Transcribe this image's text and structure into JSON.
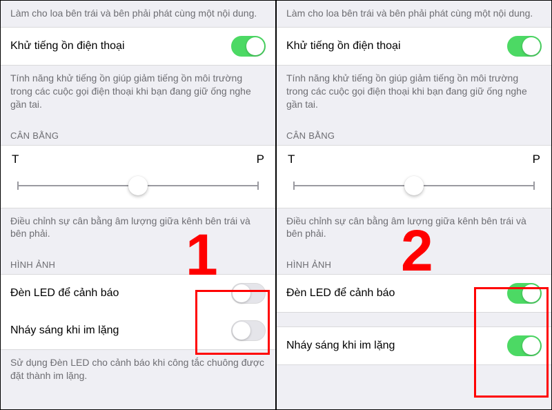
{
  "left": {
    "mono_footer": "Làm cho loa bên trái và bên phải phát cùng một nội dung.",
    "noise_cancel": {
      "label": "Khử tiếng ồn điện thoại",
      "on": true
    },
    "noise_footer": "Tính năng khử tiếng ồn giúp giảm tiếng ồn môi trường trong các cuộc gọi điện thoại khi bạn đang giữ ống nghe gần tai.",
    "balance_header": "CÂN BẰNG",
    "balance": {
      "left_label": "T",
      "right_label": "P",
      "value": 0.5
    },
    "balance_footer": "Điều chỉnh sự cân bằng âm lượng giữa kênh bên trái và bên phải.",
    "visual_header": "HÌNH ẢNH",
    "led_alert": {
      "label": "Đèn LED để cảnh báo",
      "on": false
    },
    "flash_silent": {
      "label": "Nháy sáng khi im lặng",
      "on": false
    },
    "led_footer": "Sử dụng Đèn LED cho cảnh báo khi công tắc chuông được đặt thành im lặng."
  },
  "right": {
    "mono_footer": "Làm cho loa bên trái và bên phải phát cùng một nội dung.",
    "noise_cancel": {
      "label": "Khử tiếng ồn điện thoại",
      "on": true
    },
    "noise_footer": "Tính năng khử tiếng ồn giúp giảm tiếng ồn môi trường trong các cuộc gọi điện thoại khi bạn đang giữ ống nghe gần tai.",
    "balance_header": "CÂN BẰNG",
    "balance": {
      "left_label": "T",
      "right_label": "P",
      "value": 0.5
    },
    "balance_footer": "Điều chỉnh sự cân bằng âm lượng giữa kênh bên trái và bên phải.",
    "visual_header": "HÌNH ẢNH",
    "led_alert": {
      "label": "Đèn LED để cảnh báo",
      "on": true
    },
    "flash_silent": {
      "label": "Nháy sáng khi im lặng",
      "on": true
    }
  },
  "annotations": {
    "left_number": "1",
    "right_number": "2"
  }
}
